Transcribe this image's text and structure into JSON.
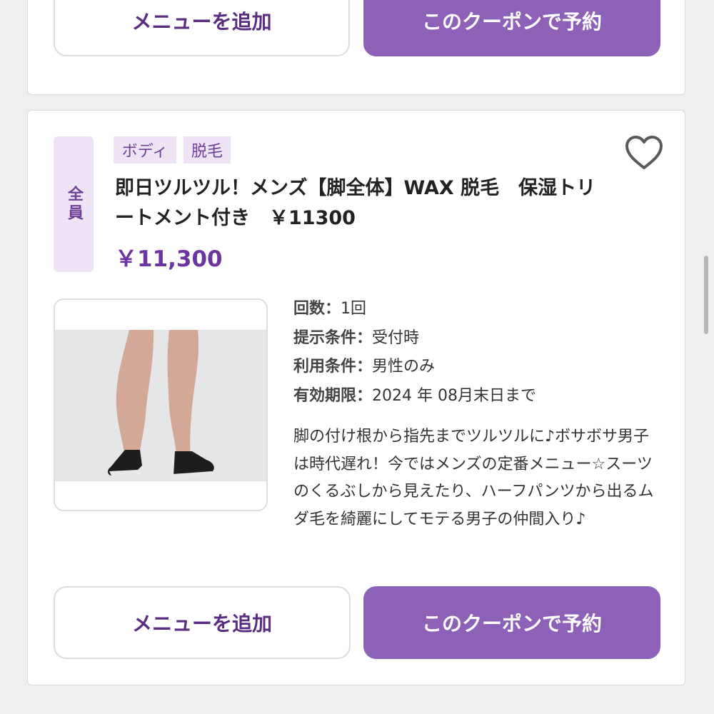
{
  "top_card": {
    "add_menu_label": "メニューを追加",
    "book_label": "このクーポンで予約"
  },
  "coupon": {
    "target": "全員",
    "tags": [
      "ボディ",
      "脱毛"
    ],
    "title": "即日ツルツル！メンズ【脚全体】WAX 脱毛　保湿トリートメント付き　￥11300",
    "price": "￥11,300",
    "image_icon": "legs-photo",
    "favorite_icon": "heart-outline-icon",
    "details": [
      {
        "key": "回数",
        "value": "1回"
      },
      {
        "key": "提示条件",
        "value": "受付時"
      },
      {
        "key": "利用条件",
        "value": "男性のみ"
      },
      {
        "key": "有効期限",
        "value": "2024 年 08月末日まで"
      }
    ],
    "separator": "：",
    "description": "脚の付け根から指先までツルツルに♪ボサボサ男子は時代遅れ！今ではメンズの定番メニュー☆スーツのくるぶしから見えたり、ハーフパンツから出るムダ毛を綺麗にしてモテる男子の仲間入り♪",
    "add_menu_label": "メニューを追加",
    "book_label": "このクーポンで予約"
  },
  "colors": {
    "accent": "#8e61b8",
    "accent_text": "#6b34a0",
    "tag_bg": "#eee4f6"
  }
}
